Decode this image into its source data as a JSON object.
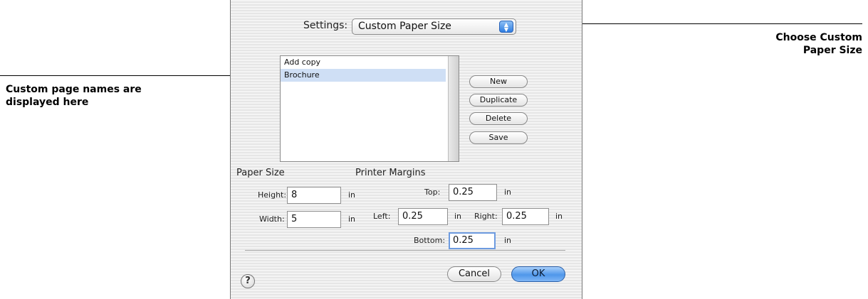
{
  "callouts": {
    "right_line1": "Choose Custom",
    "right_line2": "Paper Size",
    "left_line1": "Custom page names are",
    "left_line2": "displayed here"
  },
  "dialog": {
    "settings_label": "Settings:",
    "settings_value": "Custom Paper Size",
    "settings_icon": "popup-arrows-icon",
    "page_list": [
      "Add copy",
      "Brochure"
    ],
    "selected_page": "Brochure",
    "buttons": {
      "new": "New",
      "duplicate": "Duplicate",
      "delete": "Delete",
      "save": "Save"
    },
    "paper_size": {
      "heading": "Paper Size",
      "height_label": "Height:",
      "height_value": "8",
      "height_unit": "in",
      "width_label": "Width:",
      "width_value": "5",
      "width_unit": "in"
    },
    "margins": {
      "heading": "Printer Margins",
      "top_label": "Top:",
      "top_value": "0.25",
      "left_label": "Left:",
      "left_value": "0.25",
      "right_label": "Right:",
      "right_value": "0.25",
      "bottom_label": "Bottom:",
      "bottom_value": "0.25",
      "unit": "in"
    },
    "help_label": "?",
    "cancel_label": "Cancel",
    "ok_label": "OK"
  },
  "colors": {
    "ok_accent": "#4f97ea",
    "selection": "#cfdff5",
    "focus_ring": "#6d9be0"
  }
}
